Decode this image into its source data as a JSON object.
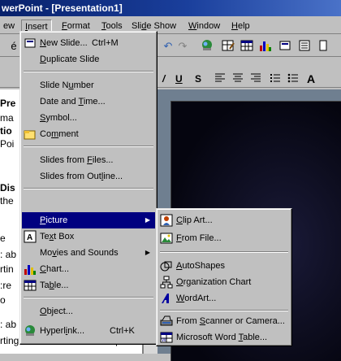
{
  "window": {
    "title": "werPoint - [Presentation1]"
  },
  "menubar": {
    "items": [
      {
        "label": "ew",
        "ul": "",
        "rest": ""
      },
      {
        "label": "",
        "ul": "I",
        "rest": "nsert"
      },
      {
        "label": "",
        "ul": "F",
        "rest": "ormat"
      },
      {
        "label": "",
        "ul": "T",
        "rest": "ools"
      },
      {
        "label": "Sli",
        "ul": "d",
        "rest": "e Show"
      },
      {
        "label": "",
        "ul": "W",
        "rest": "indow"
      },
      {
        "label": "",
        "ul": "H",
        "rest": "elp"
      }
    ]
  },
  "formatting": {
    "underline_btn": "U",
    "shadow_btn": "S"
  },
  "outline": {
    "lines": [
      {
        "text": "Pre",
        "bold": true
      },
      {
        "text": " ma",
        "bold": false
      },
      {
        "text": "tio",
        "bold": true
      },
      {
        "text": " Poi",
        "bold": false
      },
      {
        "text": "",
        "bold": false
      },
      {
        "text": " Dis",
        "bold": true
      },
      {
        "text": "the",
        "bold": false
      },
      {
        "text": "",
        "bold": false
      },
      {
        "text": "e",
        "bold": false
      },
      {
        "text": ": ab",
        "bold": false
      },
      {
        "text": "rtin",
        "bold": false
      },
      {
        "text": ":re",
        "bold": false
      },
      {
        "text": "o",
        "bold": false
      },
      {
        "text": ": ab",
        "bold": false
      },
      {
        "text": "rting information and examp",
        "bold": false
      }
    ],
    "trailing_letter": "n"
  },
  "insert_menu": {
    "items": [
      {
        "pre": "",
        "ul": "N",
        "post": "ew Slide...",
        "shortcut": "Ctrl+M",
        "icon": "new-slide-icon",
        "arrow": false,
        "selected": false
      },
      {
        "pre": "",
        "ul": "D",
        "post": "uplicate Slide",
        "shortcut": "",
        "icon": "",
        "arrow": false,
        "selected": false
      },
      {
        "sep": true
      },
      {
        "pre": "Slide N",
        "ul": "u",
        "post": "mber",
        "shortcut": "",
        "icon": "",
        "arrow": false,
        "selected": false
      },
      {
        "pre": "Date and ",
        "ul": "T",
        "post": "ime...",
        "shortcut": "",
        "icon": "",
        "arrow": false,
        "selected": false
      },
      {
        "pre": "",
        "ul": "S",
        "post": "ymbol...",
        "shortcut": "",
        "icon": "",
        "arrow": false,
        "selected": false
      },
      {
        "pre": "Co",
        "ul": "m",
        "post": "ment",
        "shortcut": "",
        "icon": "comment-icon",
        "arrow": false,
        "selected": false
      },
      {
        "sep": true
      },
      {
        "pre": "Slides from ",
        "ul": "F",
        "post": "iles...",
        "shortcut": "",
        "icon": "",
        "arrow": false,
        "selected": false
      },
      {
        "pre": "Slides from Out",
        "ul": "l",
        "post": "ine...",
        "shortcut": "",
        "icon": "",
        "arrow": false,
        "selected": false
      },
      {
        "sep": true
      },
      {
        "pre": "",
        "ul": "P",
        "post": "icture",
        "shortcut": "",
        "icon": "",
        "arrow": true,
        "selected": true
      },
      {
        "pre": "Te",
        "ul": "x",
        "post": "t Box",
        "shortcut": "",
        "icon": "text-box-icon",
        "arrow": false,
        "selected": false
      },
      {
        "pre": "Mo",
        "ul": "v",
        "post": "ies and Sounds",
        "shortcut": "",
        "icon": "",
        "arrow": true,
        "selected": false
      },
      {
        "pre": "",
        "ul": "C",
        "post": "hart...",
        "shortcut": "",
        "icon": "chart-icon",
        "arrow": false,
        "selected": false
      },
      {
        "pre": "Ta",
        "ul": "b",
        "post": "le...",
        "shortcut": "",
        "icon": "table-icon",
        "arrow": false,
        "selected": false
      },
      {
        "sep": true
      },
      {
        "pre": "",
        "ul": "O",
        "post": "bject...",
        "shortcut": "",
        "icon": "",
        "arrow": false,
        "selected": false
      },
      {
        "pre": "Hyperl",
        "ul": "i",
        "post": "nk...",
        "shortcut": "Ctrl+K",
        "icon": "hyperlink-icon",
        "arrow": false,
        "selected": false
      }
    ]
  },
  "picture_submenu": {
    "items": [
      {
        "pre": "",
        "ul": "C",
        "post": "lip Art...",
        "icon": "clip-art-icon"
      },
      {
        "pre": "",
        "ul": "F",
        "post": "rom File...",
        "icon": "from-file-icon"
      },
      {
        "sep": true
      },
      {
        "pre": "",
        "ul": "A",
        "post": "utoShapes",
        "icon": "autoshapes-icon"
      },
      {
        "pre": "",
        "ul": "O",
        "post": "rganization Chart",
        "icon": "org-chart-icon"
      },
      {
        "pre": "",
        "ul": "W",
        "post": "ordArt...",
        "icon": "wordart-icon"
      },
      {
        "sep": true
      },
      {
        "pre": "From ",
        "ul": "S",
        "post": "canner or Camera...",
        "icon": "scanner-icon"
      },
      {
        "pre": "Microsoft Word ",
        "ul": "T",
        "post": "able...",
        "icon": "word-table-icon"
      }
    ]
  }
}
